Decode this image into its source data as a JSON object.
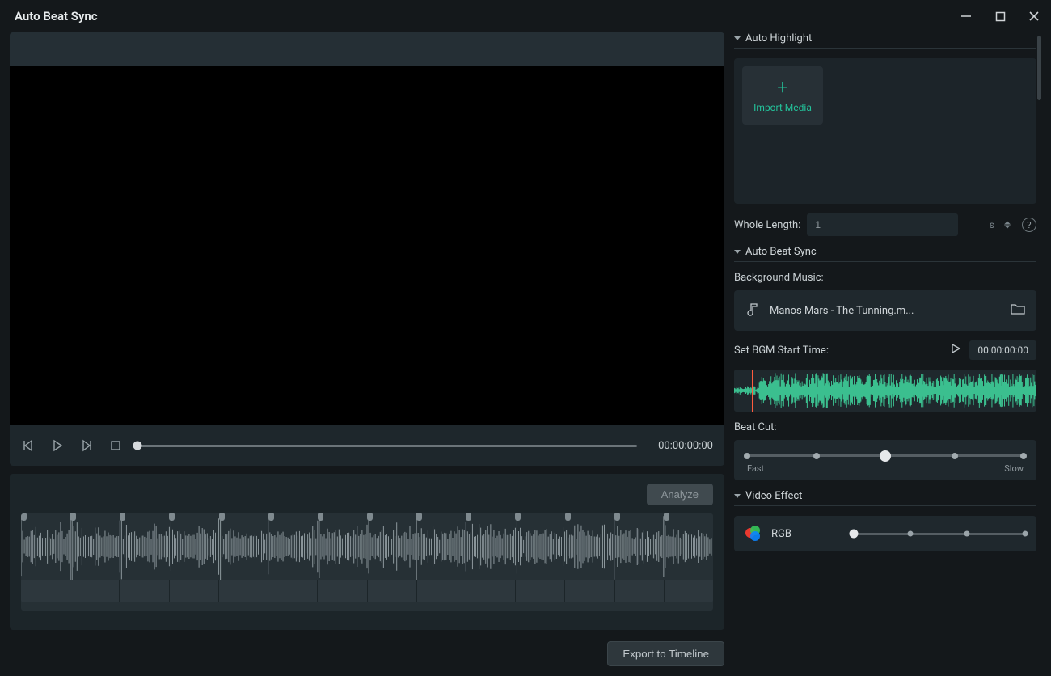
{
  "window": {
    "title": "Auto Beat Sync"
  },
  "transport": {
    "time": "00:00:00:00"
  },
  "analyze": {
    "label": "Analyze"
  },
  "export": {
    "label": "Export to Timeline"
  },
  "sidebar": {
    "auto_highlight": {
      "title": "Auto Highlight",
      "import_label": "Import Media",
      "whole_length_label": "Whole Length:",
      "whole_length_value": "1",
      "whole_length_unit": "s"
    },
    "auto_beat_sync": {
      "title": "Auto Beat Sync",
      "bg_music_label": "Background Music:",
      "track_name": "Manos Mars - The Tunning.m...",
      "bgm_start_label": "Set BGM Start Time:",
      "bgm_start_value": "00:00:00:00",
      "beat_cut_label": "Beat Cut:",
      "beat_cut_fast": "Fast",
      "beat_cut_slow": "Slow",
      "beat_cut_stops": 5,
      "beat_cut_index": 2
    },
    "video_effect": {
      "title": "Video Effect",
      "effect_name": "RGB",
      "slider_stops": 4,
      "slider_index": 0
    }
  }
}
